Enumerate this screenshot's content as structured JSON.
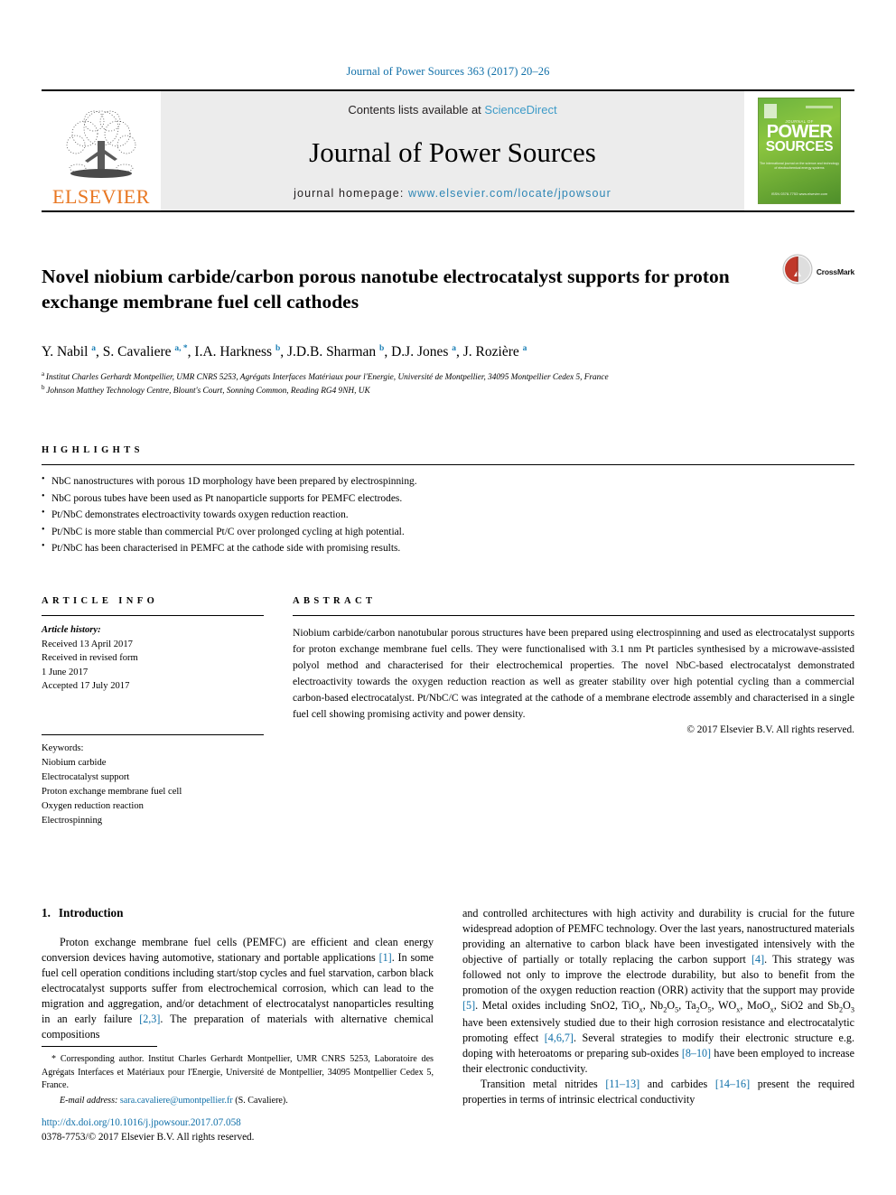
{
  "running_head": "Journal of Power Sources 363 (2017) 20–26",
  "masthead": {
    "publisher_name": "ELSEVIER",
    "contents_prefix": "Contents lists available at ",
    "contents_link": "ScienceDirect",
    "journal_name": "Journal of Power Sources",
    "homepage_prefix": "journal homepage: ",
    "homepage_url": "www.elsevier.com/locate/jpowsour",
    "cover": {
      "kicker": "JOURNAL OF",
      "title_line1": "POWER",
      "title_line2": "SOURCES",
      "subtitle": "The international journal on the science and technology of electrochemical energy systems",
      "footer": "ISSN 0378-7753\nwww.elsevier.com"
    },
    "colors": {
      "link_blue": "#3e9bc8",
      "elsevier_orange": "#E87722",
      "cover_green": "#6cb33f",
      "band_grey": "#ececec"
    }
  },
  "article": {
    "title": "Novel niobium carbide/carbon porous nanotube electrocatalyst supports for proton exchange membrane fuel cell cathodes",
    "crossmark_label": "CrossMark",
    "authors": [
      {
        "name": "Y. Nabil",
        "marks": "a"
      },
      {
        "name": "S. Cavaliere",
        "marks": "a, *"
      },
      {
        "name": "I.A. Harkness",
        "marks": "b"
      },
      {
        "name": "J.D.B. Sharman",
        "marks": "b"
      },
      {
        "name": "D.J. Jones",
        "marks": "a"
      },
      {
        "name": "J. Rozière",
        "marks": "a"
      }
    ],
    "affiliations": [
      {
        "mark": "a",
        "text": "Institut Charles Gerhardt Montpellier, UMR CNRS 5253, Agrégats Interfaces Matériaux pour l'Energie, Université de Montpellier, 34095 Montpellier Cedex 5, France"
      },
      {
        "mark": "b",
        "text": "Johnson Matthey Technology Centre, Blount's Court, Sonning Common, Reading RG4 9NH, UK"
      }
    ]
  },
  "highlights": {
    "heading": "HIGHLIGHTS",
    "items": [
      "NbC nanostructures with porous 1D morphology have been prepared by electrospinning.",
      "NbC porous tubes have been used as Pt nanoparticle supports for PEMFC electrodes.",
      "Pt/NbC demonstrates electroactivity towards oxygen reduction reaction.",
      "Pt/NbC is more stable than commercial Pt/C over prolonged cycling at high potential.",
      "Pt/NbC has been characterised in PEMFC at the cathode side with promising results."
    ]
  },
  "article_info": {
    "heading": "ARTICLE INFO",
    "history_label": "Article history:",
    "history": [
      "Received 13 April 2017",
      "Received in revised form",
      "1 June 2017",
      "Accepted 17 July 2017"
    ],
    "keywords_label": "Keywords:",
    "keywords": [
      "Niobium carbide",
      "Electrocatalyst support",
      "Proton exchange membrane fuel cell",
      "Oxygen reduction reaction",
      "Electrospinning"
    ]
  },
  "abstract": {
    "heading": "ABSTRACT",
    "text": "Niobium carbide/carbon nanotubular porous structures have been prepared using electrospinning and used as electrocatalyst supports for proton exchange membrane fuel cells. They were functionalised with 3.1 nm Pt particles synthesised by a microwave-assisted polyol method and characterised for their electrochemical properties. The novel NbC-based electrocatalyst demonstrated electroactivity towards the oxygen reduction reaction as well as greater stability over high potential cycling than a commercial carbon-based electrocatalyst. Pt/NbC/C was integrated at the cathode of a membrane electrode assembly and characterised in a single fuel cell showing promising activity and power density.",
    "copyright": "© 2017 Elsevier B.V. All rights reserved."
  },
  "introduction": {
    "number": "1.",
    "heading": "Introduction",
    "left_paragraph_parts": [
      "Proton exchange membrane fuel cells (PEMFC) are efficient and clean energy conversion devices having automotive, stationary and portable applications ",
      "[1]",
      ". In some fuel cell operation conditions including start/stop cycles and fuel starvation, carbon black electrocatalyst supports suffer from electrochemical corrosion, which can lead to the migration and aggregation, and/or detachment of electrocatalyst nanoparticles resulting in an early failure ",
      "[2,3]",
      ". The preparation of materials with alternative chemical compositions"
    ],
    "right_paragraph_1_parts": [
      "and controlled architectures with high activity and durability is crucial for the future widespread adoption of PEMFC technology. Over the last years, nanostructured materials providing an alternative to carbon black have been investigated intensively with the objective of partially or totally replacing the carbon support ",
      "[4]",
      ". This strategy was followed not only to improve the electrode durability, but also to benefit from the promotion of the oxygen reduction reaction (ORR) activity that the support may provide ",
      "[5]",
      ". Metal oxides including SnO2, TiOx, Nb2O5, Ta2O5, WOx, MoOx, SiO2 and Sb2O3 have been extensively studied due to their high corrosion resistance and electrocatalytic promoting effect ",
      "[4,6,7]",
      ". Several strategies to modify their electronic structure e.g. doping with heteroatoms or preparing sub-oxides ",
      "[8–10]",
      " have been employed to increase their electronic conductivity."
    ],
    "right_paragraph_2_parts": [
      "Transition metal nitrides ",
      "[11–13]",
      " and carbides ",
      "[14–16]",
      " present the required properties in terms of intrinsic electrical conductivity"
    ]
  },
  "footnote": {
    "corresponding": "* Corresponding author. Institut Charles Gerhardt Montpellier, UMR CNRS 5253, Laboratoire des Agrégats Interfaces et Matériaux pour l'Energie, Université de Montpellier, 34095 Montpellier Cedex 5, France.",
    "email_label": "E-mail address:",
    "email": "sara.cavaliere@umontpellier.fr",
    "email_owner": "(S. Cavaliere)."
  },
  "footer": {
    "doi": "http://dx.doi.org/10.1016/j.jpowsour.2017.07.058",
    "issn_line": "0378-7753/© 2017 Elsevier B.V. All rights reserved."
  }
}
